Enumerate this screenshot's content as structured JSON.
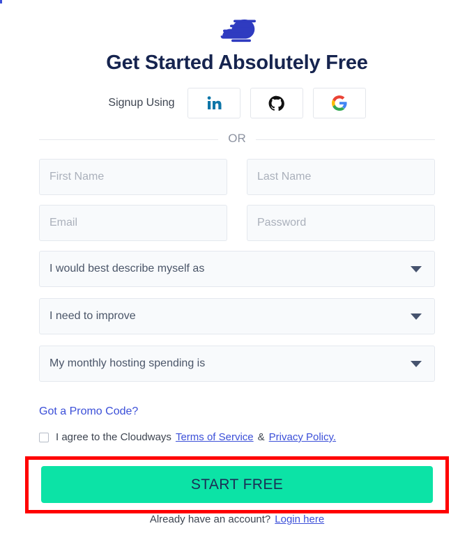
{
  "brand": {
    "logo_icon": "cloudways-cloud-logo",
    "logo_color": "#2f3bc0"
  },
  "heading": "Get Started Absolutely Free",
  "social": {
    "label": "Signup Using",
    "providers": [
      {
        "name": "linkedin",
        "icon": "linkedin-icon",
        "color": "#0e76a8"
      },
      {
        "name": "github",
        "icon": "github-icon",
        "color": "#000000"
      },
      {
        "name": "google",
        "icon": "google-icon",
        "color": "#4285f4"
      }
    ]
  },
  "divider": {
    "text": "OR"
  },
  "form": {
    "first_name": {
      "placeholder": "First Name",
      "value": ""
    },
    "last_name": {
      "placeholder": "Last Name",
      "value": ""
    },
    "email": {
      "placeholder": "Email",
      "value": ""
    },
    "password": {
      "placeholder": "Password",
      "value": ""
    },
    "describe_select": {
      "selected": "I would best describe myself as",
      "icon": "chevron-down-icon"
    },
    "improve_select": {
      "selected": "I need to improve",
      "icon": "chevron-down-icon"
    },
    "spending_select": {
      "selected": "My monthly hosting spending is",
      "icon": "chevron-down-icon"
    }
  },
  "promo_link": "Got a Promo Code?",
  "terms": {
    "checked": false,
    "text": "I agree to the Cloudways",
    "terms_link": "Terms of Service",
    "separator": "&",
    "privacy_link": "Privacy Policy."
  },
  "cta": {
    "label": "START FREE",
    "background": "#0ce3a6",
    "text_color": "#1b2d55",
    "highlight_color": "#ff0000"
  },
  "footer": {
    "text": "Already have an account?",
    "link": "Login here"
  }
}
